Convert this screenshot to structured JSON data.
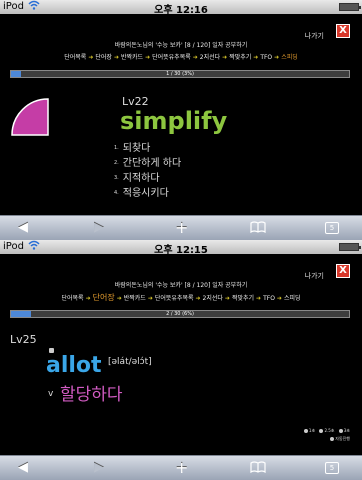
{
  "status_bar": {
    "device": "iPod",
    "wifi_icon": "wifi-icon",
    "battery_icon": "battery-icon"
  },
  "top": {
    "time": "오후 12:16",
    "exit_label": "나가기",
    "close_label": "X",
    "heading": "바람의돈노님의 '수능 보카' [8 / 120] 일자 공부하기",
    "nav": [
      "단어목록",
      "단어장",
      "반짝카드",
      "단어뜻유추목록",
      "2지선다",
      "짝맞추기",
      "TFO",
      "스피딩"
    ],
    "active_nav_index": 7,
    "progress_text": "1 / 30 (3%)",
    "progress_fraction": 0.03,
    "level": "Lv22",
    "word": "simplify",
    "word_color": "#8dc63f",
    "meanings": [
      {
        "num": "1.",
        "text": "되찾다"
      },
      {
        "num": "2.",
        "text": "간단하게 하다"
      },
      {
        "num": "3.",
        "text": "지적하다"
      },
      {
        "num": "4.",
        "text": "적응시키다"
      }
    ],
    "timer_color": "#c53da6"
  },
  "bottom": {
    "time": "오후 12:15",
    "exit_label": "나가기",
    "close_label": "X",
    "heading": "바람의돈노님의 '수능 보카' [8 / 120] 일자 공부하기",
    "nav": [
      "단어목록",
      "단어장",
      "반짝카드",
      "단어뜻유추목록",
      "2지선다",
      "짝맞추기",
      "TFO",
      "스피딩"
    ],
    "active_nav_index": 1,
    "progress_text": "2 / 30 (6%)",
    "progress_fraction": 0.06,
    "level": "Lv25",
    "word": "allot",
    "word_color": "#3aa6e8",
    "phonetic": "[əlát/əlɔ́t]",
    "pos": "v",
    "meaning": "할당하다",
    "meaning_color": "#d15bc2",
    "speed_options": [
      "1초",
      "2.5초",
      "3초"
    ],
    "auto_label": "자동진행"
  },
  "toolbar": {
    "back": "◀",
    "forward": "▶",
    "add": "+",
    "bookmarks": "📖",
    "tabs_count": "5"
  },
  "colors": {
    "accent_orange": "#e39b2d",
    "arrow_yellow": "#d4c22a",
    "progress_blue": "#4d88d8"
  }
}
